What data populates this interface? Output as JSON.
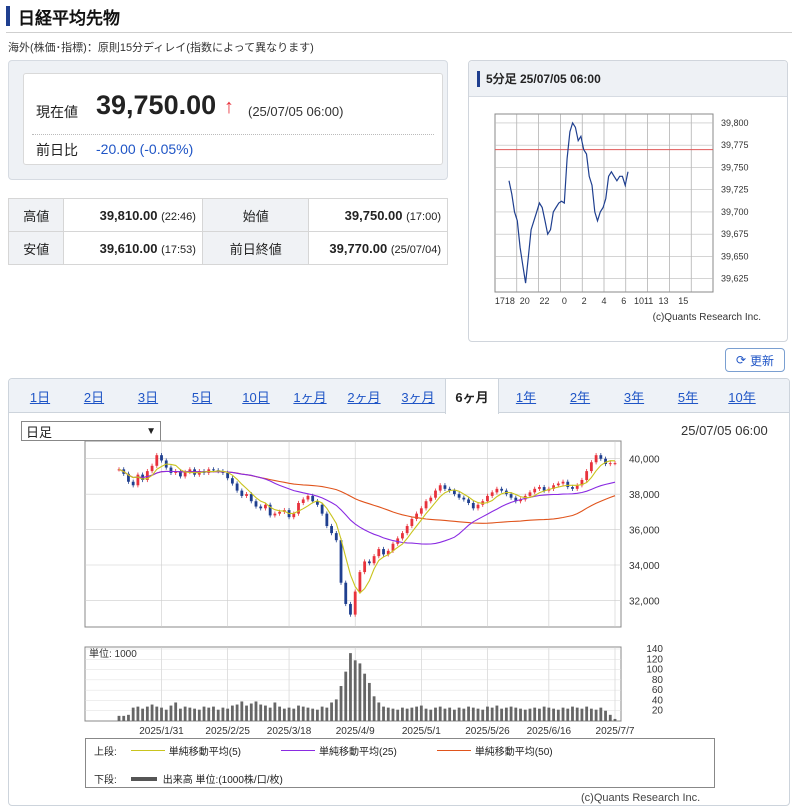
{
  "header": {
    "title": "日経平均先物",
    "note": "海外(株価･指標)：原則15分ディレイ(指数によって異なります)"
  },
  "quote": {
    "current_label": "現在値",
    "current_value": "39,750.00",
    "arrow": "↑",
    "current_time": "(25/07/05 06:00)",
    "change_label": "前日比",
    "change_value": "-20.00 (-0.05%)"
  },
  "ohlc": {
    "high_label": "高値",
    "high_value": "39,810.00",
    "high_time": "(22:46)",
    "open_label": "始値",
    "open_value": "39,750.00",
    "open_time": "(17:00)",
    "low_label": "安値",
    "low_value": "39,610.00",
    "low_time": "(17:53)",
    "prev_label": "前日終値",
    "prev_value": "39,770.00",
    "prev_time": "(25/07/04)"
  },
  "intraday": {
    "title": "5分足 25/07/05 06:00",
    "copyright": "(c)Quants Research Inc.",
    "chart_data": {
      "type": "line",
      "y_ticks": [
        "39,800",
        "39,775",
        "39,750",
        "39,725",
        "39,700",
        "39,675",
        "39,650",
        "39,625"
      ],
      "x_ticks": [
        "1718",
        "20",
        "22",
        "0",
        "2",
        "4",
        "6",
        "1011",
        "13",
        "15"
      ],
      "ylim": [
        39610,
        39810
      ],
      "reference_line": 39770,
      "series": [
        {
          "values": [
            39735,
            39720,
            39700,
            39690,
            39660,
            39640,
            39620,
            39650,
            39680,
            39690,
            39700,
            39710,
            39705,
            39690,
            39675,
            39680,
            39700,
            39705,
            39710,
            39712,
            39710,
            39760,
            39790,
            39800,
            39795,
            39780,
            39785,
            39770,
            39765,
            39740,
            39730,
            39700,
            39690,
            39700,
            39705,
            39715,
            39740,
            39745,
            39740,
            39735,
            39740,
            39740,
            39730,
            39745
          ]
        }
      ]
    }
  },
  "refresh_label": "更新",
  "tabs": [
    "1日",
    "2日",
    "3日",
    "5日",
    "10日",
    "1ヶ月",
    "2ヶ月",
    "3ヶ月",
    "6ヶ月",
    "1年",
    "2年",
    "3年",
    "5年",
    "10年"
  ],
  "active_tab": "6ヶ月",
  "period_select": "日足",
  "chart_time": "25/07/05 06:00",
  "daily_chart": {
    "chart_data": {
      "type": "candlestick",
      "y_ticks": [
        "40,000",
        "38,000",
        "36,000",
        "34,000",
        "32,000"
      ],
      "ylim": [
        30500,
        41000
      ],
      "x_ticks": [
        "2025/1/31",
        "2025/2/25",
        "2025/3/18",
        "2025/4/9",
        "2025/5/1",
        "2025/5/26",
        "2025/6/16",
        "2025/7/7"
      ],
      "close": [
        39400,
        39150,
        38700,
        38500,
        39100,
        38800,
        39300,
        39600,
        40200,
        39900,
        39500,
        39200,
        39300,
        39000,
        39250,
        39400,
        39100,
        39300,
        39200,
        39400,
        39350,
        39300,
        39200,
        38900,
        38600,
        38200,
        37900,
        38000,
        37600,
        37300,
        37200,
        37400,
        36800,
        36900,
        37000,
        37100,
        36700,
        36900,
        37500,
        37700,
        37900,
        37600,
        37400,
        36900,
        36200,
        35800,
        35400,
        33000,
        31800,
        31200,
        32500,
        33600,
        34200,
        34100,
        34500,
        34900,
        34600,
        34800,
        35200,
        35500,
        35800,
        36200,
        36600,
        36900,
        37200,
        37600,
        37800,
        38200,
        38500,
        38300,
        38200,
        38000,
        37800,
        37700,
        37500,
        37200,
        37400,
        37600,
        37900,
        38100,
        38300,
        38200,
        38000,
        37800,
        37600,
        37700,
        37900,
        38100,
        38300,
        38400,
        38200,
        38300,
        38500,
        38600,
        38700,
        38400,
        38300,
        38500,
        38800,
        39300,
        39800,
        40200,
        40000,
        39700,
        39750,
        39750
      ],
      "volume": [
        10,
        10,
        12,
        26,
        28,
        24,
        28,
        32,
        28,
        26,
        22,
        30,
        36,
        24,
        28,
        26,
        24,
        22,
        28,
        26,
        28,
        22,
        26,
        24,
        30,
        32,
        38,
        30,
        34,
        38,
        32,
        30,
        26,
        36,
        28,
        24,
        26,
        24,
        30,
        28,
        26,
        24,
        22,
        28,
        26,
        36,
        42,
        68,
        96,
        132,
        118,
        112,
        92,
        74,
        48,
        36,
        28,
        26,
        24,
        22,
        26,
        24,
        26,
        28,
        30,
        24,
        22,
        26,
        28,
        24,
        26,
        22,
        26,
        24,
        28,
        26,
        24,
        22,
        28,
        26,
        30,
        24,
        26,
        28,
        26,
        24,
        22,
        24,
        26,
        24,
        28,
        26,
        24,
        22,
        26,
        24,
        28,
        26,
        24,
        28,
        24,
        22,
        26,
        20,
        12,
        4
      ],
      "volume_unit": "単位: 1000",
      "volume_ticks": [
        "140",
        "120",
        "100",
        "80",
        "60",
        "40",
        "20"
      ],
      "volume_max": 140,
      "upper_legend": "上段:",
      "lower_legend": "下段:",
      "ma5_label": "単純移動平均(5)",
      "ma25_label": "単純移動平均(25)",
      "ma50_label": "単純移動平均(50)",
      "volume_label": "出来高 単位:(1000株/口/枚)",
      "colors": {
        "up": "#e8323c",
        "down": "#1f3f8f",
        "ma5": "#c9c41e",
        "ma25": "#8a2be2",
        "ma50": "#e0541c"
      }
    },
    "copyright": "(c)Quants Research Inc."
  }
}
